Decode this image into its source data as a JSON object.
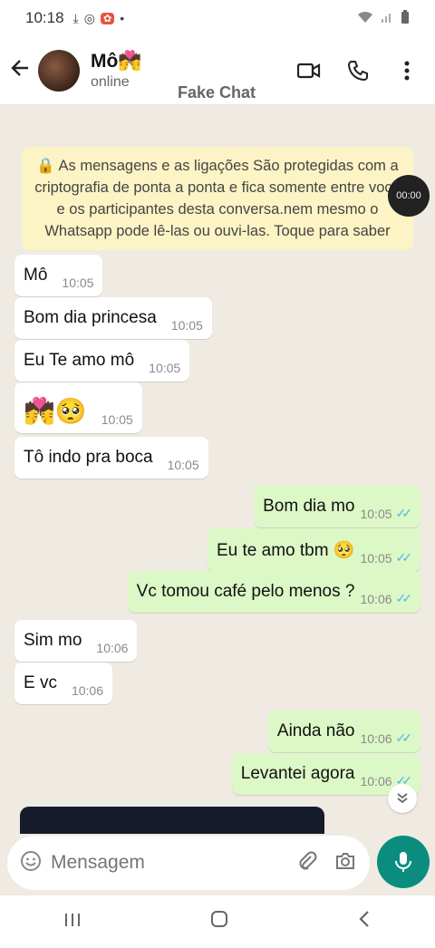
{
  "status_bar": {
    "time": "10:18",
    "dot": "•"
  },
  "header": {
    "contact_name": "Mô💏",
    "contact_status": "online",
    "watermark": "Fake Chat"
  },
  "notice": {
    "text": "🔒 As mensagens e as ligações São protegidas com a criptografia de ponta a ponta e fica somente entre você e os participantes desta conversa.nem mesmo o Whatsapp pode lê-las ou ouvi-las. Toque para saber"
  },
  "timer": {
    "label": "00:00"
  },
  "messages": [
    {
      "text": "Mô",
      "time": "10:05",
      "dir": "in"
    },
    {
      "text": "Bom dia princesa",
      "time": "10:05",
      "dir": "in"
    },
    {
      "text": "Eu Te amo mô",
      "time": "10:05",
      "dir": "in"
    },
    {
      "text": "💏🥺",
      "time": "10:05",
      "dir": "in"
    },
    {
      "text": "Tô indo pra boca",
      "time": "10:05",
      "dir": "in"
    },
    {
      "text": "Bom dia mo",
      "time": "10:05",
      "dir": "out",
      "ticks": "✓✓"
    },
    {
      "text": "Eu te amo tbm 🥺",
      "time": "10:05",
      "dir": "out",
      "ticks": "✓✓"
    },
    {
      "text": "Vc tomou café pelo menos ?",
      "time": "10:06",
      "dir": "out",
      "ticks": "✓✓"
    },
    {
      "text": "Sim mo",
      "time": "10:06",
      "dir": "in"
    },
    {
      "text": "E vc",
      "time": "10:06",
      "dir": "in"
    },
    {
      "text": "Ainda não",
      "time": "10:06",
      "dir": "out",
      "ticks": "✓✓"
    },
    {
      "text": "Levantei agora",
      "time": "10:06",
      "dir": "out",
      "ticks": "✓✓"
    }
  ],
  "composer": {
    "placeholder": "Mensagem"
  },
  "colors": {
    "accent": "#0a8d7e",
    "bubble_out": "#dcf8c6",
    "bubble_in": "#ffffff",
    "notice": "#fdf4c5",
    "read_ticks": "#4fb6ec"
  },
  "icons": [
    "back-arrow-icon",
    "video-call-icon",
    "phone-icon",
    "more-options-icon",
    "emoji-icon",
    "attach-icon",
    "camera-icon",
    "mic-icon",
    "scroll-down-icon",
    "recents-icon",
    "home-icon",
    "back-nav-icon"
  ]
}
